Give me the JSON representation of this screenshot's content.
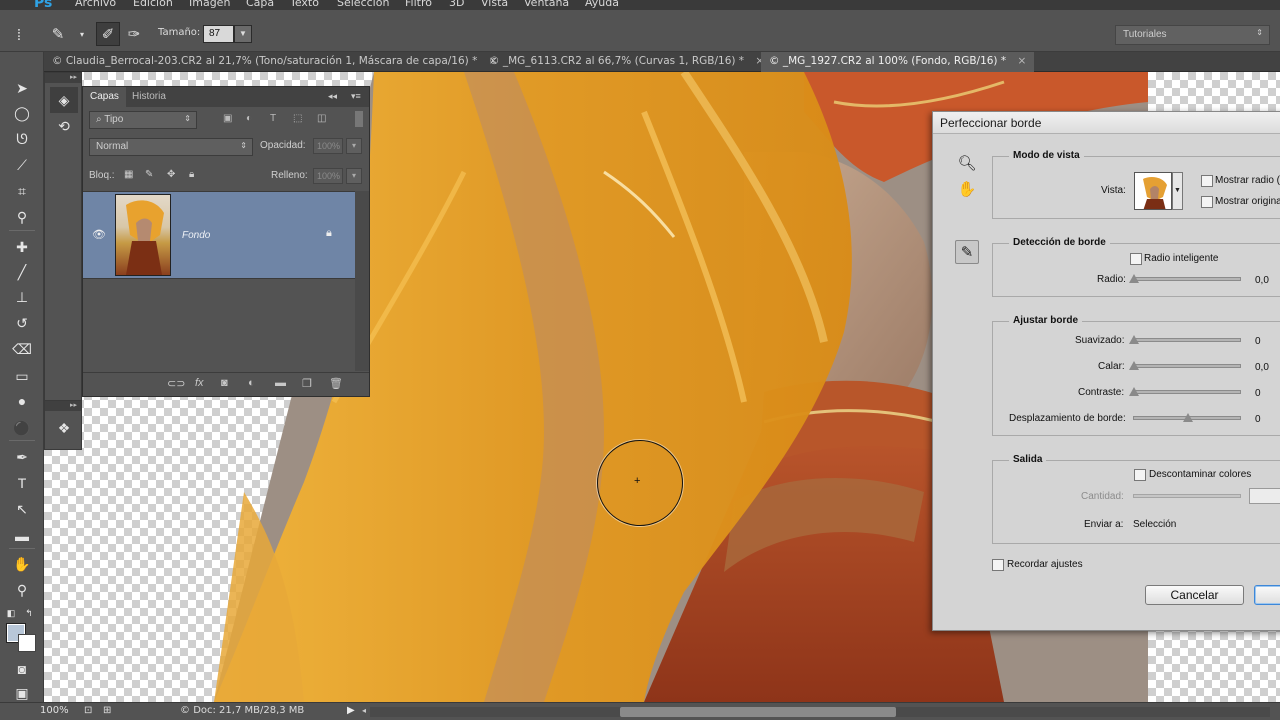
{
  "app": {
    "logo": "Ps",
    "menu": [
      "Archivo",
      "Edición",
      "Imagen",
      "Capa",
      "Texto",
      "Selección",
      "Filtro",
      "3D",
      "Vista",
      "Ventana",
      "Ayuda"
    ]
  },
  "options_bar": {
    "size_label": "Tamaño:",
    "size_value": "87",
    "workspace": "Tutoriales"
  },
  "tabs": [
    {
      "label": "Claudia_Berrocal-203.CR2 al 21,7% (Tono/saturación 1, Máscara de capa/16) *",
      "active": false
    },
    {
      "label": "_MG_6113.CR2 al 66,7% (Curvas 1, RGB/16) *",
      "active": false
    },
    {
      "label": "_MG_1927.CR2 al 100% (Fondo, RGB/16) *",
      "active": true
    }
  ],
  "layers_panel": {
    "tab_layers": "Capas",
    "tab_history": "Historia",
    "filter_type": "Tipo",
    "blend_mode": "Normal",
    "opacity_label": "Opacidad:",
    "opacity_value": "100%",
    "lock_label": "Bloq.:",
    "fill_label": "Relleno:",
    "fill_value": "100%",
    "layers": [
      {
        "name": "Fondo",
        "visible": true,
        "locked": true
      }
    ]
  },
  "dialog": {
    "title": "Perfeccionar borde",
    "view_mode": {
      "title": "Modo de vista",
      "view_label": "Vista:",
      "show_radius": "Mostrar radio (",
      "show_original": "Mostrar original"
    },
    "edge_detection": {
      "title": "Detección de borde",
      "smart_radius": "Radio inteligente",
      "radius_label": "Radio:",
      "radius_value": "0,0"
    },
    "adjust_edge": {
      "title": "Ajustar borde",
      "smooth_label": "Suavizado:",
      "smooth_value": "0",
      "feather_label": "Calar:",
      "feather_value": "0,0",
      "contrast_label": "Contraste:",
      "contrast_value": "0",
      "shift_label": "Desplazamiento de borde:",
      "shift_value": "0"
    },
    "output": {
      "title": "Salida",
      "decontaminate": "Descontaminar colores",
      "amount_label": "Cantidad:",
      "send_to_label": "Enviar a:",
      "send_to_value": "Selección"
    },
    "remember": "Recordar ajustes",
    "cancel": "Cancelar"
  },
  "status": {
    "zoom": "100%",
    "doc": "Doc: 21,7 MB/28,3 MB"
  },
  "colors": {
    "panel": "#535353",
    "layer_selected": "#6f85a6",
    "accent": "#2fa3e6",
    "fabric": "#e9a02a"
  }
}
